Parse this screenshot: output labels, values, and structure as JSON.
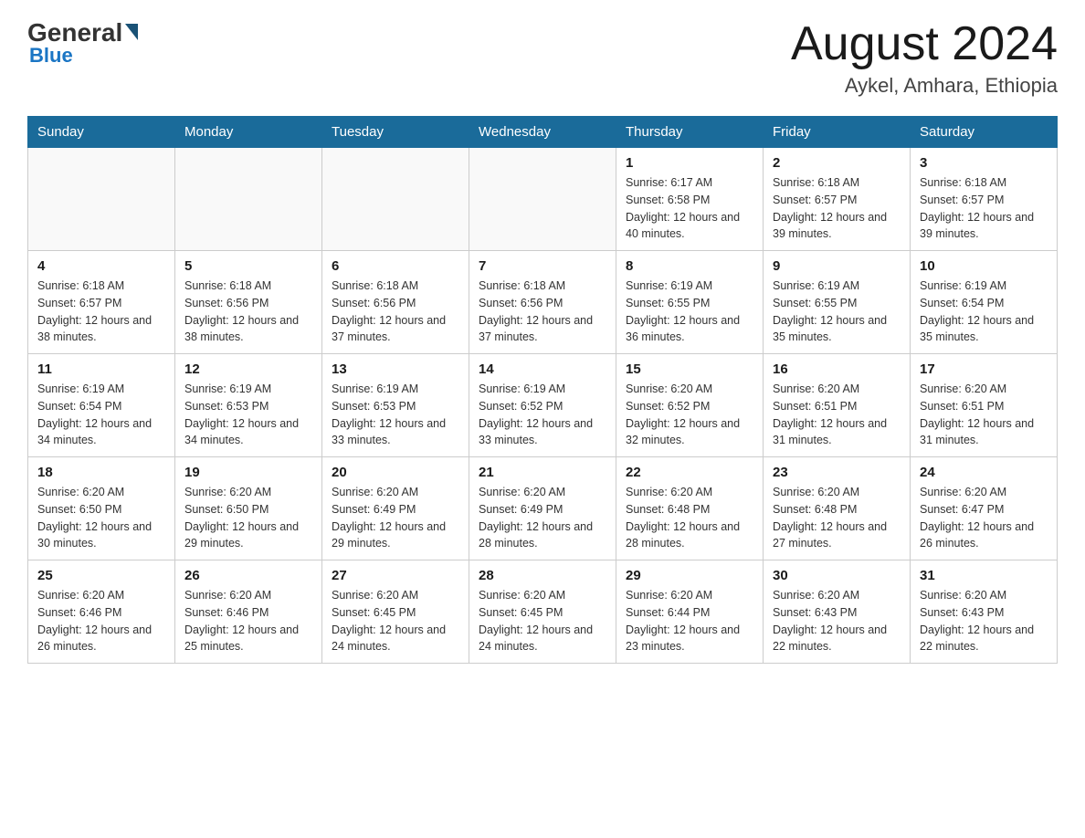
{
  "header": {
    "logo_general": "General",
    "logo_arrow": "▶",
    "logo_blue": "Blue",
    "month_title": "August 2024",
    "location": "Aykel, Amhara, Ethiopia"
  },
  "days_of_week": [
    "Sunday",
    "Monday",
    "Tuesday",
    "Wednesday",
    "Thursday",
    "Friday",
    "Saturday"
  ],
  "weeks": [
    [
      {
        "day": "",
        "info": ""
      },
      {
        "day": "",
        "info": ""
      },
      {
        "day": "",
        "info": ""
      },
      {
        "day": "",
        "info": ""
      },
      {
        "day": "1",
        "info": "Sunrise: 6:17 AM\nSunset: 6:58 PM\nDaylight: 12 hours and 40 minutes."
      },
      {
        "day": "2",
        "info": "Sunrise: 6:18 AM\nSunset: 6:57 PM\nDaylight: 12 hours and 39 minutes."
      },
      {
        "day": "3",
        "info": "Sunrise: 6:18 AM\nSunset: 6:57 PM\nDaylight: 12 hours and 39 minutes."
      }
    ],
    [
      {
        "day": "4",
        "info": "Sunrise: 6:18 AM\nSunset: 6:57 PM\nDaylight: 12 hours and 38 minutes."
      },
      {
        "day": "5",
        "info": "Sunrise: 6:18 AM\nSunset: 6:56 PM\nDaylight: 12 hours and 38 minutes."
      },
      {
        "day": "6",
        "info": "Sunrise: 6:18 AM\nSunset: 6:56 PM\nDaylight: 12 hours and 37 minutes."
      },
      {
        "day": "7",
        "info": "Sunrise: 6:18 AM\nSunset: 6:56 PM\nDaylight: 12 hours and 37 minutes."
      },
      {
        "day": "8",
        "info": "Sunrise: 6:19 AM\nSunset: 6:55 PM\nDaylight: 12 hours and 36 minutes."
      },
      {
        "day": "9",
        "info": "Sunrise: 6:19 AM\nSunset: 6:55 PM\nDaylight: 12 hours and 35 minutes."
      },
      {
        "day": "10",
        "info": "Sunrise: 6:19 AM\nSunset: 6:54 PM\nDaylight: 12 hours and 35 minutes."
      }
    ],
    [
      {
        "day": "11",
        "info": "Sunrise: 6:19 AM\nSunset: 6:54 PM\nDaylight: 12 hours and 34 minutes."
      },
      {
        "day": "12",
        "info": "Sunrise: 6:19 AM\nSunset: 6:53 PM\nDaylight: 12 hours and 34 minutes."
      },
      {
        "day": "13",
        "info": "Sunrise: 6:19 AM\nSunset: 6:53 PM\nDaylight: 12 hours and 33 minutes."
      },
      {
        "day": "14",
        "info": "Sunrise: 6:19 AM\nSunset: 6:52 PM\nDaylight: 12 hours and 33 minutes."
      },
      {
        "day": "15",
        "info": "Sunrise: 6:20 AM\nSunset: 6:52 PM\nDaylight: 12 hours and 32 minutes."
      },
      {
        "day": "16",
        "info": "Sunrise: 6:20 AM\nSunset: 6:51 PM\nDaylight: 12 hours and 31 minutes."
      },
      {
        "day": "17",
        "info": "Sunrise: 6:20 AM\nSunset: 6:51 PM\nDaylight: 12 hours and 31 minutes."
      }
    ],
    [
      {
        "day": "18",
        "info": "Sunrise: 6:20 AM\nSunset: 6:50 PM\nDaylight: 12 hours and 30 minutes."
      },
      {
        "day": "19",
        "info": "Sunrise: 6:20 AM\nSunset: 6:50 PM\nDaylight: 12 hours and 29 minutes."
      },
      {
        "day": "20",
        "info": "Sunrise: 6:20 AM\nSunset: 6:49 PM\nDaylight: 12 hours and 29 minutes."
      },
      {
        "day": "21",
        "info": "Sunrise: 6:20 AM\nSunset: 6:49 PM\nDaylight: 12 hours and 28 minutes."
      },
      {
        "day": "22",
        "info": "Sunrise: 6:20 AM\nSunset: 6:48 PM\nDaylight: 12 hours and 28 minutes."
      },
      {
        "day": "23",
        "info": "Sunrise: 6:20 AM\nSunset: 6:48 PM\nDaylight: 12 hours and 27 minutes."
      },
      {
        "day": "24",
        "info": "Sunrise: 6:20 AM\nSunset: 6:47 PM\nDaylight: 12 hours and 26 minutes."
      }
    ],
    [
      {
        "day": "25",
        "info": "Sunrise: 6:20 AM\nSunset: 6:46 PM\nDaylight: 12 hours and 26 minutes."
      },
      {
        "day": "26",
        "info": "Sunrise: 6:20 AM\nSunset: 6:46 PM\nDaylight: 12 hours and 25 minutes."
      },
      {
        "day": "27",
        "info": "Sunrise: 6:20 AM\nSunset: 6:45 PM\nDaylight: 12 hours and 24 minutes."
      },
      {
        "day": "28",
        "info": "Sunrise: 6:20 AM\nSunset: 6:45 PM\nDaylight: 12 hours and 24 minutes."
      },
      {
        "day": "29",
        "info": "Sunrise: 6:20 AM\nSunset: 6:44 PM\nDaylight: 12 hours and 23 minutes."
      },
      {
        "day": "30",
        "info": "Sunrise: 6:20 AM\nSunset: 6:43 PM\nDaylight: 12 hours and 22 minutes."
      },
      {
        "day": "31",
        "info": "Sunrise: 6:20 AM\nSunset: 6:43 PM\nDaylight: 12 hours and 22 minutes."
      }
    ]
  ]
}
